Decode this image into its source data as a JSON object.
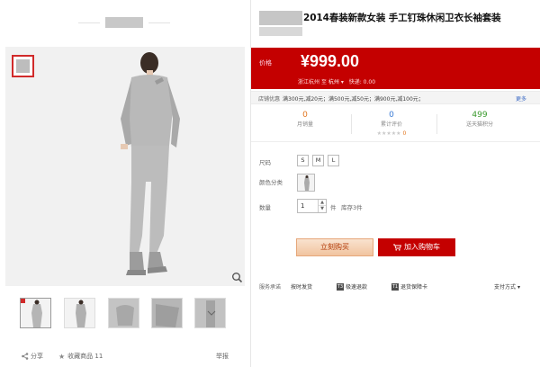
{
  "product": {
    "title": "2014春装新款女装 手工钉珠休闲卫衣长袖套装",
    "price_label": "价格",
    "price": "¥999.00",
    "ship_origin": "浙江杭州",
    "ship_to_word": "至",
    "ship_dest": "杭州",
    "ship_fee": "快递: 0.00"
  },
  "promotions": {
    "label": "店铺优惠",
    "items": "满300元,减20元；满500元,减50元；满900元,减100元；",
    "more": "更多"
  },
  "stats": [
    {
      "value": "0",
      "label": "月销量"
    },
    {
      "value": "0",
      "label": "累计评价",
      "stars": "★★★★★",
      "rating": "0"
    },
    {
      "value": "499",
      "label": "送天猫积分"
    }
  ],
  "options": {
    "size_label": "尺码",
    "sizes": [
      "S",
      "M",
      "L"
    ],
    "color_label": "颜色分类",
    "qty_label": "数量",
    "qty_value": "1",
    "qty_unit": "件",
    "stock": "库存3件"
  },
  "actions": {
    "buy_now": "立刻购买",
    "add_cart": "加入购物车"
  },
  "service": {
    "label": "服务承诺",
    "items": [
      {
        "tag": "",
        "text": "按时发货"
      },
      {
        "tag": "T3",
        "text": "极速退款"
      },
      {
        "tag": "T1",
        "text": "退货保障卡"
      }
    ],
    "pay": "支付方式"
  },
  "share": {
    "share_label": "分享",
    "fav_label": "收藏商品 11",
    "report_label": "举报"
  },
  "colors": {
    "accent_red": "#c40000",
    "promo_blue": "#3a69c4"
  }
}
